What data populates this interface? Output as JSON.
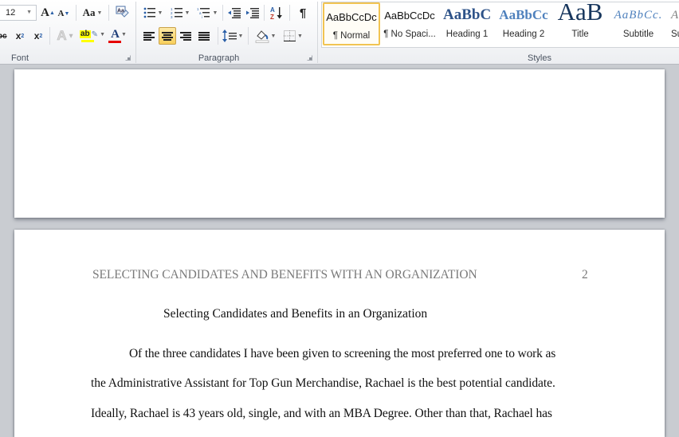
{
  "ribbon": {
    "font_group": {
      "label": "Font",
      "font_size": "12",
      "grow_font": "A",
      "shrink_font": "A",
      "change_case": "Aa",
      "clear_formatting_icon": "clear-formatting-icon",
      "strikethrough": "abc",
      "subscript": "x",
      "subscript_mark": "2",
      "superscript": "x",
      "superscript_mark": "2",
      "text_effects": "A",
      "highlight": "ab",
      "highlight_color": "#ffff00",
      "font_color_letter": "A",
      "font_color": "#e60000"
    },
    "paragraph_group": {
      "label": "Paragraph",
      "sort": "A Z",
      "show_marks": "¶",
      "active_alignment": "center"
    },
    "styles_group": {
      "label": "Styles",
      "styles": [
        {
          "sample": "AaBbCcDc",
          "name": "¶ Normal",
          "selected": true
        },
        {
          "sample": "AaBbCcDc",
          "name": "¶ No Spaci...",
          "selected": false
        },
        {
          "sample": "AaBbC",
          "name": "Heading 1",
          "selected": false
        },
        {
          "sample": "AaBbCc",
          "name": "Heading 2",
          "selected": false
        },
        {
          "sample": "AaB",
          "name": "Title",
          "selected": false
        },
        {
          "sample": "AaBbCc.",
          "name": "Subtitle",
          "selected": false
        },
        {
          "sample": "A",
          "name": "Su",
          "selected": false
        }
      ]
    }
  },
  "document": {
    "running_header": "SELECTING CANDIDATES AND BENEFITS WITH AN ORGANIZATION",
    "page_number": "2",
    "title": "Selecting Candidates and Benefits in an Organization",
    "paragraph_lines": [
      "Of the three candidates I have been given to screening the most preferred one to work as",
      "the Administrative Assistant for Top Gun Merchandise, Rachael is the best potential candidate.",
      "Ideally, Rachael is 43 years old, single, and with an MBA Degree. Other than that, Rachael has"
    ]
  }
}
